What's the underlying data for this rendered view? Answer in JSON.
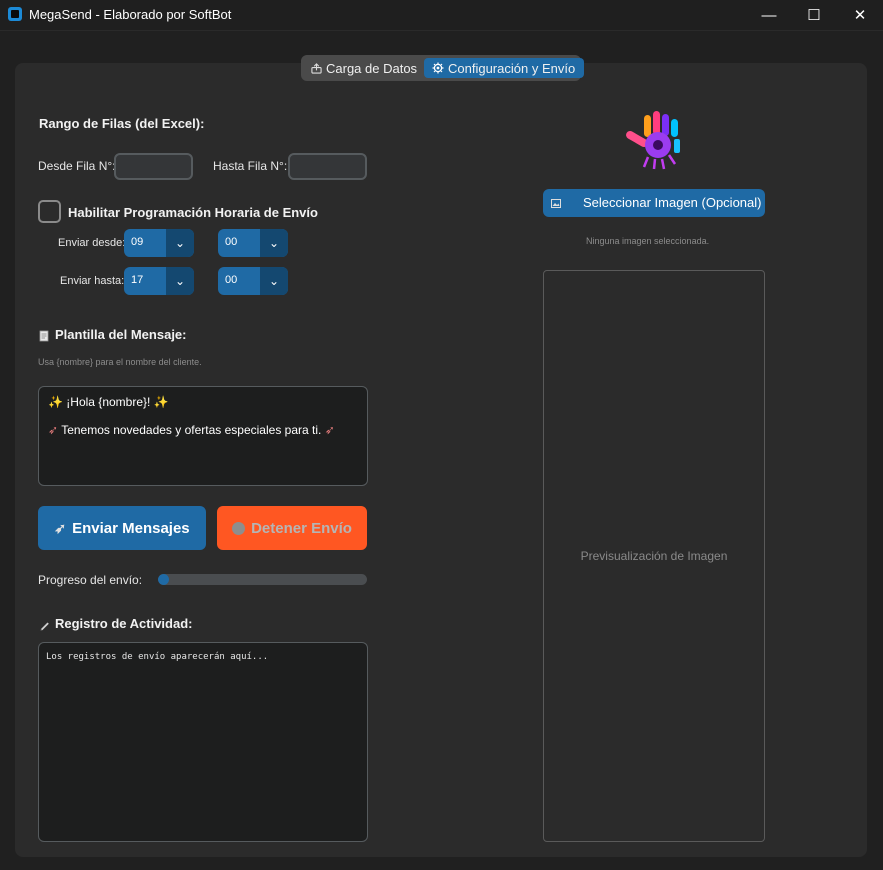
{
  "window": {
    "title": "MegaSend - Elaborado por SoftBot",
    "minimize_glyph": "—",
    "maximize_glyph": "☐",
    "close_glyph": "✕"
  },
  "tabs": [
    {
      "icon": "upload-icon",
      "label": "Carga de Datos",
      "active": false
    },
    {
      "icon": "gear-icon",
      "label": "Configuración y Envío",
      "active": true
    }
  ],
  "range": {
    "heading": "Rango de Filas (del Excel):",
    "from_label": "Desde Fila N°:",
    "from_value": "",
    "to_label": "Hasta Fila N°:",
    "to_value": ""
  },
  "schedule": {
    "checkbox_label": "Habilitar Programación Horaria de Envío",
    "checked": false,
    "send_from_label": "Enviar desde:",
    "send_from_hour": "09",
    "send_from_minute": "00",
    "send_to_label": "Enviar hasta:",
    "send_to_hour": "17",
    "send_to_minute": "00"
  },
  "template": {
    "heading": "Plantilla del Mensaje:",
    "hint": "Usa {nombre} para el nombre del cliente.",
    "line1": "¡Hola {nombre}!",
    "line2": "Tenemos novedades y ofertas especiales para ti."
  },
  "actions": {
    "send_label": "Enviar Mensajes",
    "stop_label": "Detener Envío",
    "send_color": "#1f6aa5",
    "stop_color": "#ff5722"
  },
  "progress": {
    "label": "Progreso del envío:",
    "value": 0.0
  },
  "log": {
    "heading": "Registro de Actividad:",
    "text": "Los registros de envío aparecerán aquí..."
  },
  "image": {
    "select_button": "Seleccionar Imagen (Opcional)",
    "status": "Ninguna imagen seleccionada.",
    "preview_placeholder": "Previsualización de Imagen"
  }
}
